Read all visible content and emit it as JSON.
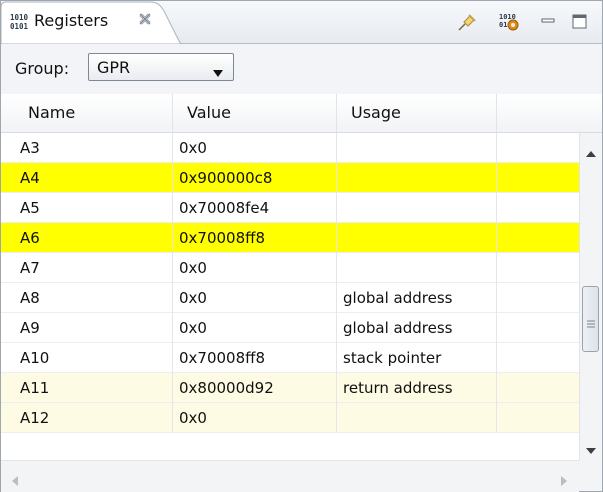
{
  "view": {
    "tab_title": "Registers",
    "tab_icon": "binary-registers-icon",
    "toolbar_icons": [
      "pin-icon",
      "register-settings-icon",
      "minimize-icon",
      "maximize-icon"
    ]
  },
  "group": {
    "label": "Group:",
    "selected": "GPR"
  },
  "table": {
    "columns": [
      "Name",
      "Value",
      "Usage"
    ],
    "rows": [
      {
        "name": "A3",
        "value": "0x0",
        "usage": "",
        "highlight": "none"
      },
      {
        "name": "A4",
        "value": "0x900000c8",
        "usage": "",
        "highlight": "changed"
      },
      {
        "name": "A5",
        "value": "0x70008fe4",
        "usage": "",
        "highlight": "none"
      },
      {
        "name": "A6",
        "value": "0x70008ff8",
        "usage": "",
        "highlight": "changed"
      },
      {
        "name": "A7",
        "value": "0x0",
        "usage": "",
        "highlight": "none"
      },
      {
        "name": "A8",
        "value": "0x0",
        "usage": "global address",
        "highlight": "none"
      },
      {
        "name": "A9",
        "value": "0x0",
        "usage": "global address",
        "highlight": "none"
      },
      {
        "name": "A10",
        "value": "0x70008ff8",
        "usage": "stack pointer",
        "highlight": "none"
      },
      {
        "name": "A11",
        "value": "0x80000d92",
        "usage": "return address",
        "highlight": "pale"
      },
      {
        "name": "A12",
        "value": "0x0",
        "usage": "",
        "highlight": "pale"
      }
    ]
  },
  "colors": {
    "changed_row": "#ffff00",
    "pale_row": "#fdfbe4"
  }
}
